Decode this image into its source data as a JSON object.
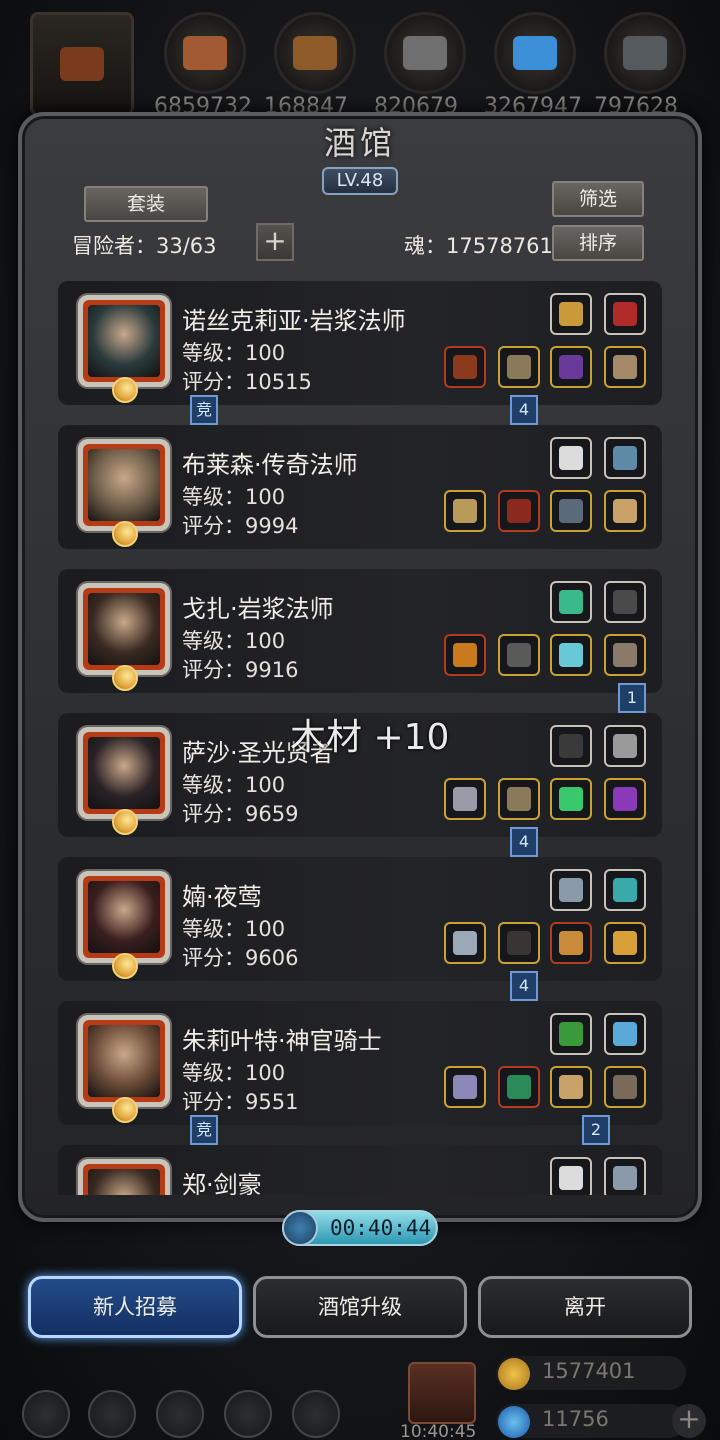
{
  "resources": [
    {
      "name": "axe-icon",
      "value": "",
      "color": "#7a3a1c"
    },
    {
      "name": "leather-icon",
      "value": "6859732",
      "color": "#a25a32"
    },
    {
      "name": "wood-icon",
      "value": "168847",
      "color": "#8e5a2a"
    },
    {
      "name": "stone-icon",
      "value": "820679",
      "color": "#6f6f6f"
    },
    {
      "name": "crystal-icon",
      "value": "3267947",
      "color": "#3a8fd6"
    },
    {
      "name": "iron-icon",
      "value": "797628",
      "color": "#555a5e"
    }
  ],
  "panel": {
    "title": "酒馆",
    "level": "LV.48",
    "set_button": "套装",
    "filter_button": "筛选",
    "sort_button": "排序",
    "adventurers_label": "冒险者：33/63",
    "plus_button": "+",
    "soul_label": "魂：17578761"
  },
  "heroes": [
    {
      "name": "诺丝克莉亚·岩浆法师",
      "level": "等级：100",
      "score": "评分：10515",
      "face": "#2a3b3d",
      "top_slots": [
        {
          "icon": "lantern-icon",
          "color": "#c99a3a",
          "frame": "white"
        },
        {
          "icon": "feather-icon",
          "color": "#b02a2a",
          "frame": "white"
        }
      ],
      "bottom_slots": [
        {
          "icon": "staff-icon",
          "color": "#8b3a1e",
          "frame": "red"
        },
        {
          "icon": "armor-icon",
          "color": "#8a7a5a",
          "frame": "gold"
        },
        {
          "icon": "orb-icon",
          "color": "#6a3a9a",
          "frame": "gold"
        },
        {
          "icon": "glove-icon",
          "color": "#a58a6a",
          "frame": "gold"
        }
      ],
      "tag_left": "竞",
      "tag_right": "4"
    },
    {
      "name": "布莱森·传奇法师",
      "level": "等级：100",
      "score": "评分：9994",
      "face": "#6b5a46",
      "top_slots": [
        {
          "icon": "wing-icon",
          "color": "#dcdcdc",
          "frame": "white"
        },
        {
          "icon": "tome-icon",
          "color": "#5e8aa8",
          "frame": "white"
        }
      ],
      "bottom_slots": [
        {
          "icon": "wand-icon",
          "color": "#b89a5a",
          "frame": "gold"
        },
        {
          "icon": "robe-icon",
          "color": "#8a2a1e",
          "frame": "red"
        },
        {
          "icon": "sword-icon",
          "color": "#5a6a7a",
          "frame": "gold"
        },
        {
          "icon": "scroll-icon",
          "color": "#c9a26a",
          "frame": "gold"
        }
      ],
      "tag_left": "",
      "tag_right": ""
    },
    {
      "name": "戈扎·岩浆法师",
      "level": "等级：100",
      "score": "评分：9916",
      "face": "#3a2a22",
      "top_slots": [
        {
          "icon": "gem-icon",
          "color": "#3ab98a",
          "frame": "white"
        },
        {
          "icon": "quill-icon",
          "color": "#4a4a4a",
          "frame": "white"
        }
      ],
      "bottom_slots": [
        {
          "icon": "staff-icon",
          "color": "#c97a1e",
          "frame": "red"
        },
        {
          "icon": "armor-icon",
          "color": "#5a5a5a",
          "frame": "gold"
        },
        {
          "icon": "rune-icon",
          "color": "#6ac9d6",
          "frame": "gold"
        },
        {
          "icon": "glove-icon",
          "color": "#8a7a6a",
          "frame": "gold"
        }
      ],
      "tag_left": "",
      "tag_right": "1"
    },
    {
      "name": "萨沙·圣光贤者",
      "level": "等级：100",
      "score": "评分：9659",
      "face": "#2a2226",
      "top_slots": [
        {
          "icon": "spear-icon",
          "color": "#3a3a3a",
          "frame": "white"
        },
        {
          "icon": "feather-icon",
          "color": "#9a9a9a",
          "frame": "white"
        }
      ],
      "bottom_slots": [
        {
          "icon": "hammer-icon",
          "color": "#9a9aa8",
          "frame": "gold"
        },
        {
          "icon": "armor-icon",
          "color": "#8a7a5a",
          "frame": "gold"
        },
        {
          "icon": "emerald-icon",
          "color": "#3ac96a",
          "frame": "gold"
        },
        {
          "icon": "star-icon",
          "color": "#8a3ab9",
          "frame": "gold"
        }
      ],
      "tag_left": "",
      "tag_right": "4"
    },
    {
      "name": "婻·夜莺",
      "level": "等级：100",
      "score": "评分：9606",
      "face": "#3a1e1e",
      "top_slots": [
        {
          "icon": "amulet-icon",
          "color": "#8a9aaa",
          "frame": "white"
        },
        {
          "icon": "gem-icon",
          "color": "#3aa9a9",
          "frame": "white"
        }
      ],
      "bottom_slots": [
        {
          "icon": "dagger-icon",
          "color": "#9aa8b8",
          "frame": "gold"
        },
        {
          "icon": "vest-icon",
          "color": "#3a3432",
          "frame": "gold"
        },
        {
          "icon": "medal-icon",
          "color": "#c98a3a",
          "frame": "red"
        },
        {
          "icon": "ring-icon",
          "color": "#d9a03a",
          "frame": "gold"
        }
      ],
      "tag_left": "",
      "tag_right": "4"
    },
    {
      "name": "朱莉叶特·神官骑士",
      "level": "等级：100",
      "score": "评分：9551",
      "face": "#6a4a36",
      "top_slots": [
        {
          "icon": "book-icon",
          "color": "#3a9a3a",
          "frame": "white"
        },
        {
          "icon": "boot-icon",
          "color": "#5aa9d9",
          "frame": "white"
        }
      ],
      "bottom_slots": [
        {
          "icon": "mace-icon",
          "color": "#8a8ab8",
          "frame": "gold"
        },
        {
          "icon": "armor-icon",
          "color": "#2a8a5a",
          "frame": "red"
        },
        {
          "icon": "scroll-icon",
          "color": "#c9a26a",
          "frame": "gold"
        },
        {
          "icon": "bow-icon",
          "color": "#7a6a5a",
          "frame": "gold"
        }
      ],
      "tag_left": "竞",
      "tag_right": "2"
    },
    {
      "name": "郑·剑豪",
      "level": "",
      "score": "",
      "face": "#3a2a22",
      "top_slots": [
        {
          "icon": "wing-icon",
          "color": "#dcdcdc",
          "frame": "white"
        },
        {
          "icon": "amulet-icon",
          "color": "#8a9aaa",
          "frame": "white"
        }
      ],
      "bottom_slots": [],
      "tag_left": "",
      "tag_right": ""
    }
  ],
  "float_text": "木材 +10",
  "timer": "00:40:44",
  "buttons": {
    "recruit": "新人招募",
    "upgrade": "酒馆升级",
    "leave": "离开"
  },
  "footer": {
    "time": "10:40:45",
    "gold": "1577401",
    "gems": "11756",
    "plus": "+"
  }
}
